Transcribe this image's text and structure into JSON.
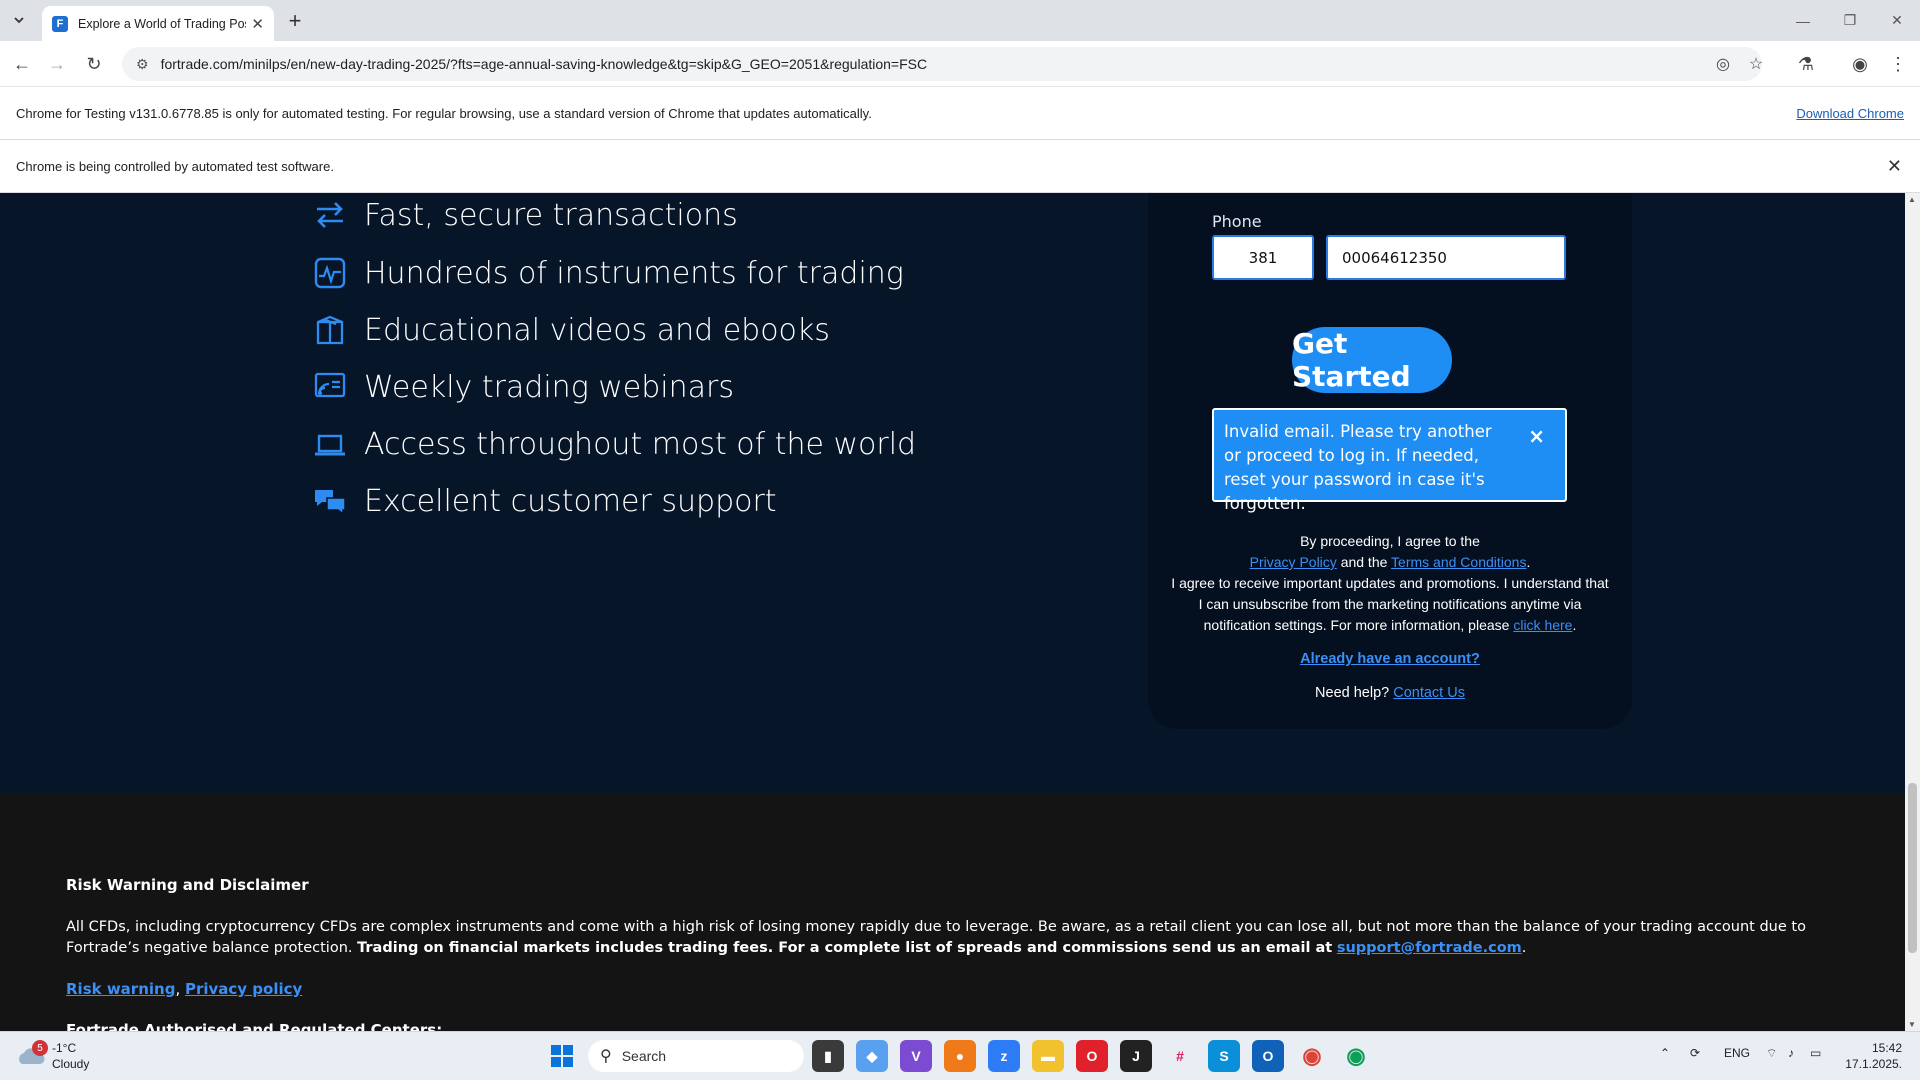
{
  "browser": {
    "tab_title": "Explore a World of Trading Pos",
    "url": "fortrade.com/minilps/en/new-day-trading-2025/?fts=age-annual-saving-knowledge&tg=skip&G_GEO=2051&regulation=FSC",
    "infobar_testing": "Chrome for Testing v131.0.6778.85 is only for automated testing. For regular browsing, use a standard version of Chrome that updates automatically.",
    "infobar_download": "Download Chrome",
    "infobar_automation": "Chrome is being controlled by automated test software."
  },
  "features": [
    {
      "icon": "transfer-arrows-icon",
      "label": "Fast, secure transactions"
    },
    {
      "icon": "chart-monitor-icon",
      "label": "Hundreds of instruments for trading"
    },
    {
      "icon": "book-box-icon",
      "label": "Educational videos and ebooks"
    },
    {
      "icon": "webinar-icon",
      "label": "Weekly trading webinars"
    },
    {
      "icon": "laptop-icon",
      "label": "Access throughout most of the world"
    },
    {
      "icon": "chat-bubbles-icon",
      "label": "Excellent customer support"
    }
  ],
  "form": {
    "phone_label": "Phone",
    "country_code": "381",
    "phone_number": "00064612350",
    "cta": "Get Started",
    "error": "Invalid email. Please try another or proceed to log in. If needed, reset your password in case it's forgotten.",
    "error_close": "×",
    "legal_1": "By proceeding, I agree to the",
    "privacy_policy": "Privacy Policy",
    "and_the": "and the",
    "terms": "Terms and Conditions",
    "legal_2": "I agree to receive important updates and promotions. I understand that I can unsubscribe from the marketing notifications anytime via notification settings. For more information, please",
    "click_here": "click here",
    "already": "Already have an account?",
    "need_help": "Need help?",
    "contact_us": "Contact Us"
  },
  "footer": {
    "risk_title": "Risk Warning and Disclaimer",
    "risk_text": "All CFDs, including cryptocurrency CFDs are complex instruments and come with a high risk of losing money rapidly due to leverage. Be aware, as a retail client you can lose all, but not more than the balance of your trading account due to Fortrade’s negative balance protection.",
    "risk_bold": "Trading on financial markets includes trading fees. For a complete list of spreads and commissions send us an email at",
    "email": "support@fortrade.com",
    "link_risk": "Risk warning",
    "link_privacy": "Privacy policy",
    "centers": "Fortrade Authorised and Regulated Centers:"
  },
  "taskbar": {
    "weather_temp": "-1°C",
    "weather_desc": "Cloudy",
    "weather_badge": "5",
    "search_label": "Search",
    "lang": "ENG",
    "time": "15:42",
    "date": "17.1.2025."
  }
}
